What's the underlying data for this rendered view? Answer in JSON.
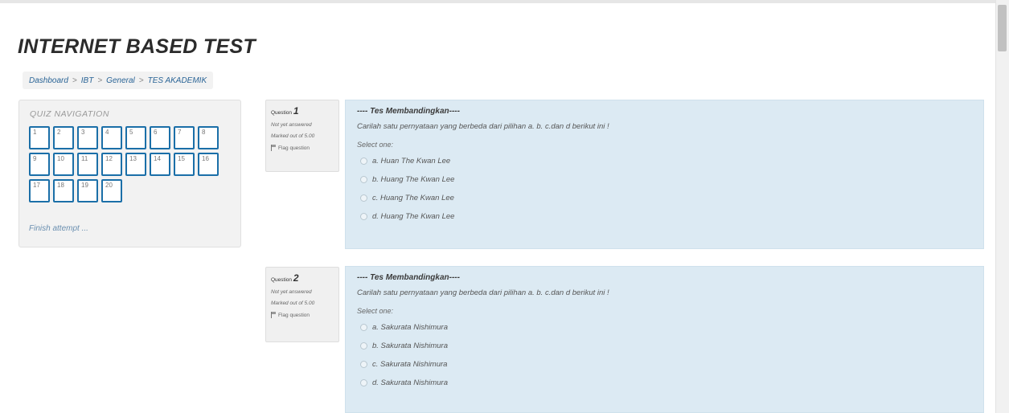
{
  "page_title": "INTERNET BASED TEST",
  "breadcrumb": [
    "Dashboard",
    "IBT",
    "General",
    "TES AKADEMIK"
  ],
  "breadcrumb_sep": ">",
  "quiz_nav": {
    "title": "QUIZ NAVIGATION",
    "buttons": [
      "1",
      "2",
      "3",
      "4",
      "5",
      "6",
      "7",
      "8",
      "9",
      "10",
      "11",
      "12",
      "13",
      "14",
      "15",
      "16",
      "17",
      "18",
      "19",
      "20"
    ],
    "finish_label": "Finish attempt ..."
  },
  "questions": [
    {
      "label": "Question",
      "number": "1",
      "state": "Not yet answered",
      "grade": "Marked out of 5.00",
      "flag_label": "Flag question",
      "title": "---- Tes Membandingkan----",
      "text": "Carilah satu pernyataan yang berbeda dari pilihan a. b. c.dan d berikut ini !",
      "select_label": "Select one:",
      "answers": [
        "a. Huan The Kwan Lee",
        "b. Huang The Kwan Lee",
        "c. Huang The Kwan Lee",
        "d. Huang The Kwan Lee"
      ]
    },
    {
      "label": "Question",
      "number": "2",
      "state": "Not yet answered",
      "grade": "Marked out of 5.00",
      "flag_label": "Flag question",
      "title": "---- Tes Membandingkan----",
      "text": "Carilah satu pernyataan yang berbeda dari pilihan a. b. c.dan d berikut ini !",
      "select_label": "Select one:",
      "answers": [
        "a. Sakurata Nishimura",
        "b. Sakurata Nishimura",
        "c. Sakurata Nishimura",
        "d. Sakurata Nishimura"
      ]
    }
  ],
  "colors": {
    "nav_border": "#1b6fa8",
    "question_bg": "#dceaf3",
    "info_bg": "#f0f0f0"
  }
}
